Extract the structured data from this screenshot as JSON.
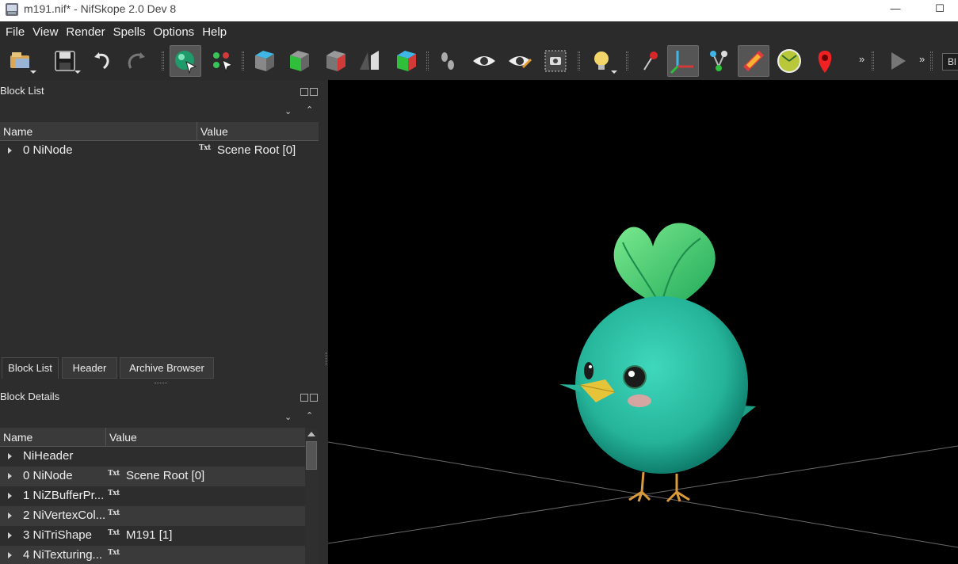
{
  "window": {
    "title": "m191.nif* - NifSkope 2.0 Dev 8",
    "minimize_glyph": "—",
    "maximize_glyph": "☐"
  },
  "menu": [
    "File",
    "View",
    "Render",
    "Spells",
    "Options",
    "Help"
  ],
  "toolbar": {
    "more_glyph": "»",
    "combo_text": "Bl",
    "icons": [
      "open-icon",
      "save-icon",
      "undo-icon",
      "redo-icon",
      "select-object-icon",
      "select-vertex-icon",
      "view-top-icon",
      "view-front-icon",
      "view-side-icon",
      "view-user-icon",
      "view-flip-icon",
      "walk-icon",
      "eye-icon",
      "eye-paint-icon",
      "screenshot-icon",
      "lighting-icon",
      "pin-icon",
      "axes-icon",
      "nodes-icon",
      "havok-icon",
      "furniture-icon",
      "marker-icon",
      "play-icon"
    ]
  },
  "block_list": {
    "title": "Block List",
    "columns": [
      "Name",
      "Value"
    ],
    "rows": [
      {
        "name": "0 NiNode",
        "value": "Scene Root [0]"
      }
    ],
    "tabs": [
      "Block List",
      "Header",
      "Archive Browser"
    ]
  },
  "block_details": {
    "title": "Block Details",
    "columns": [
      "Name",
      "Value"
    ],
    "rows": [
      {
        "name": "NiHeader",
        "value": "",
        "txt": false
      },
      {
        "name": "0 NiNode",
        "value": "Scene Root [0]",
        "txt": true
      },
      {
        "name": "1 NiZBufferPr...",
        "value": "",
        "txt": true
      },
      {
        "name": "2 NiVertexCol...",
        "value": "",
        "txt": true
      },
      {
        "name": "3 NiTriShape",
        "value": "M191 [1]",
        "txt": true
      },
      {
        "name": "4 NiTexturing...",
        "value": "",
        "txt": true
      }
    ]
  },
  "txt_badge": "Txt",
  "colors": {
    "background": "#303030",
    "viewport": "#000000",
    "bird_body": "#2bbfa4",
    "bird_crest": "#4fd27a",
    "beak": "#e6c43a",
    "feet": "#d99a3a"
  }
}
